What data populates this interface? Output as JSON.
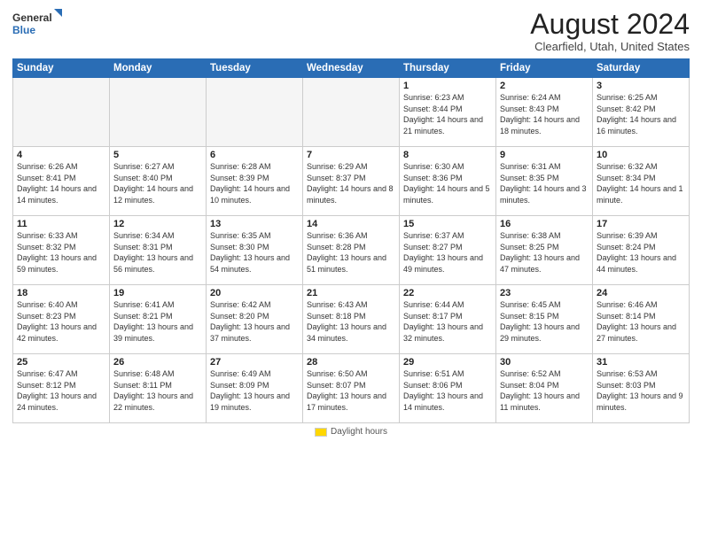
{
  "header": {
    "logo_general": "General",
    "logo_blue": "Blue",
    "title": "August 2024",
    "location": "Clearfield, Utah, United States"
  },
  "weekdays": [
    "Sunday",
    "Monday",
    "Tuesday",
    "Wednesday",
    "Thursday",
    "Friday",
    "Saturday"
  ],
  "footer": {
    "legend_label": "Daylight hours"
  },
  "weeks": [
    [
      {
        "day": "",
        "empty": true
      },
      {
        "day": "",
        "empty": true
      },
      {
        "day": "",
        "empty": true
      },
      {
        "day": "",
        "empty": true
      },
      {
        "day": "1",
        "sunrise": "Sunrise: 6:23 AM",
        "sunset": "Sunset: 8:44 PM",
        "daylight": "Daylight: 14 hours and 21 minutes."
      },
      {
        "day": "2",
        "sunrise": "Sunrise: 6:24 AM",
        "sunset": "Sunset: 8:43 PM",
        "daylight": "Daylight: 14 hours and 18 minutes."
      },
      {
        "day": "3",
        "sunrise": "Sunrise: 6:25 AM",
        "sunset": "Sunset: 8:42 PM",
        "daylight": "Daylight: 14 hours and 16 minutes."
      }
    ],
    [
      {
        "day": "4",
        "sunrise": "Sunrise: 6:26 AM",
        "sunset": "Sunset: 8:41 PM",
        "daylight": "Daylight: 14 hours and 14 minutes."
      },
      {
        "day": "5",
        "sunrise": "Sunrise: 6:27 AM",
        "sunset": "Sunset: 8:40 PM",
        "daylight": "Daylight: 14 hours and 12 minutes."
      },
      {
        "day": "6",
        "sunrise": "Sunrise: 6:28 AM",
        "sunset": "Sunset: 8:39 PM",
        "daylight": "Daylight: 14 hours and 10 minutes."
      },
      {
        "day": "7",
        "sunrise": "Sunrise: 6:29 AM",
        "sunset": "Sunset: 8:37 PM",
        "daylight": "Daylight: 14 hours and 8 minutes."
      },
      {
        "day": "8",
        "sunrise": "Sunrise: 6:30 AM",
        "sunset": "Sunset: 8:36 PM",
        "daylight": "Daylight: 14 hours and 5 minutes."
      },
      {
        "day": "9",
        "sunrise": "Sunrise: 6:31 AM",
        "sunset": "Sunset: 8:35 PM",
        "daylight": "Daylight: 14 hours and 3 minutes."
      },
      {
        "day": "10",
        "sunrise": "Sunrise: 6:32 AM",
        "sunset": "Sunset: 8:34 PM",
        "daylight": "Daylight: 14 hours and 1 minute."
      }
    ],
    [
      {
        "day": "11",
        "sunrise": "Sunrise: 6:33 AM",
        "sunset": "Sunset: 8:32 PM",
        "daylight": "Daylight: 13 hours and 59 minutes."
      },
      {
        "day": "12",
        "sunrise": "Sunrise: 6:34 AM",
        "sunset": "Sunset: 8:31 PM",
        "daylight": "Daylight: 13 hours and 56 minutes."
      },
      {
        "day": "13",
        "sunrise": "Sunrise: 6:35 AM",
        "sunset": "Sunset: 8:30 PM",
        "daylight": "Daylight: 13 hours and 54 minutes."
      },
      {
        "day": "14",
        "sunrise": "Sunrise: 6:36 AM",
        "sunset": "Sunset: 8:28 PM",
        "daylight": "Daylight: 13 hours and 51 minutes."
      },
      {
        "day": "15",
        "sunrise": "Sunrise: 6:37 AM",
        "sunset": "Sunset: 8:27 PM",
        "daylight": "Daylight: 13 hours and 49 minutes."
      },
      {
        "day": "16",
        "sunrise": "Sunrise: 6:38 AM",
        "sunset": "Sunset: 8:25 PM",
        "daylight": "Daylight: 13 hours and 47 minutes."
      },
      {
        "day": "17",
        "sunrise": "Sunrise: 6:39 AM",
        "sunset": "Sunset: 8:24 PM",
        "daylight": "Daylight: 13 hours and 44 minutes."
      }
    ],
    [
      {
        "day": "18",
        "sunrise": "Sunrise: 6:40 AM",
        "sunset": "Sunset: 8:23 PM",
        "daylight": "Daylight: 13 hours and 42 minutes."
      },
      {
        "day": "19",
        "sunrise": "Sunrise: 6:41 AM",
        "sunset": "Sunset: 8:21 PM",
        "daylight": "Daylight: 13 hours and 39 minutes."
      },
      {
        "day": "20",
        "sunrise": "Sunrise: 6:42 AM",
        "sunset": "Sunset: 8:20 PM",
        "daylight": "Daylight: 13 hours and 37 minutes."
      },
      {
        "day": "21",
        "sunrise": "Sunrise: 6:43 AM",
        "sunset": "Sunset: 8:18 PM",
        "daylight": "Daylight: 13 hours and 34 minutes."
      },
      {
        "day": "22",
        "sunrise": "Sunrise: 6:44 AM",
        "sunset": "Sunset: 8:17 PM",
        "daylight": "Daylight: 13 hours and 32 minutes."
      },
      {
        "day": "23",
        "sunrise": "Sunrise: 6:45 AM",
        "sunset": "Sunset: 8:15 PM",
        "daylight": "Daylight: 13 hours and 29 minutes."
      },
      {
        "day": "24",
        "sunrise": "Sunrise: 6:46 AM",
        "sunset": "Sunset: 8:14 PM",
        "daylight": "Daylight: 13 hours and 27 minutes."
      }
    ],
    [
      {
        "day": "25",
        "sunrise": "Sunrise: 6:47 AM",
        "sunset": "Sunset: 8:12 PM",
        "daylight": "Daylight: 13 hours and 24 minutes."
      },
      {
        "day": "26",
        "sunrise": "Sunrise: 6:48 AM",
        "sunset": "Sunset: 8:11 PM",
        "daylight": "Daylight: 13 hours and 22 minutes."
      },
      {
        "day": "27",
        "sunrise": "Sunrise: 6:49 AM",
        "sunset": "Sunset: 8:09 PM",
        "daylight": "Daylight: 13 hours and 19 minutes."
      },
      {
        "day": "28",
        "sunrise": "Sunrise: 6:50 AM",
        "sunset": "Sunset: 8:07 PM",
        "daylight": "Daylight: 13 hours and 17 minutes."
      },
      {
        "day": "29",
        "sunrise": "Sunrise: 6:51 AM",
        "sunset": "Sunset: 8:06 PM",
        "daylight": "Daylight: 13 hours and 14 minutes."
      },
      {
        "day": "30",
        "sunrise": "Sunrise: 6:52 AM",
        "sunset": "Sunset: 8:04 PM",
        "daylight": "Daylight: 13 hours and 11 minutes."
      },
      {
        "day": "31",
        "sunrise": "Sunrise: 6:53 AM",
        "sunset": "Sunset: 8:03 PM",
        "daylight": "Daylight: 13 hours and 9 minutes."
      }
    ]
  ]
}
